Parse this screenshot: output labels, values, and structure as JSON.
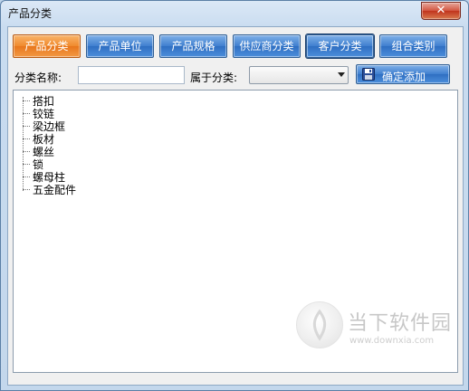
{
  "window": {
    "title": "产品分类",
    "close_symbol": "✕"
  },
  "tabs": [
    {
      "label": "产品分类",
      "state": "active"
    },
    {
      "label": "产品单位",
      "state": "normal"
    },
    {
      "label": "产品规格",
      "state": "normal"
    },
    {
      "label": "供应商分类",
      "state": "normal"
    },
    {
      "label": "客户分类",
      "state": "focused"
    },
    {
      "label": "组合类别",
      "state": "normal"
    }
  ],
  "form": {
    "name_label": "分类名称:",
    "name_value": "",
    "parent_label": "属于分类:",
    "parent_selected": "",
    "confirm_label": "确定添加",
    "confirm_icon": "floppy-disk-icon"
  },
  "tree": {
    "items": [
      "搭扣",
      "铰链",
      "梁边框",
      "板材",
      "螺丝",
      "锁",
      "螺母柱",
      "五金配件"
    ]
  },
  "watermark": {
    "text": "当下软件园",
    "url": "www.downxia.com"
  },
  "colors": {
    "active_tab": "#f08a2e",
    "tab_blue": "#3f7fcf",
    "close_red": "#c0341d"
  }
}
